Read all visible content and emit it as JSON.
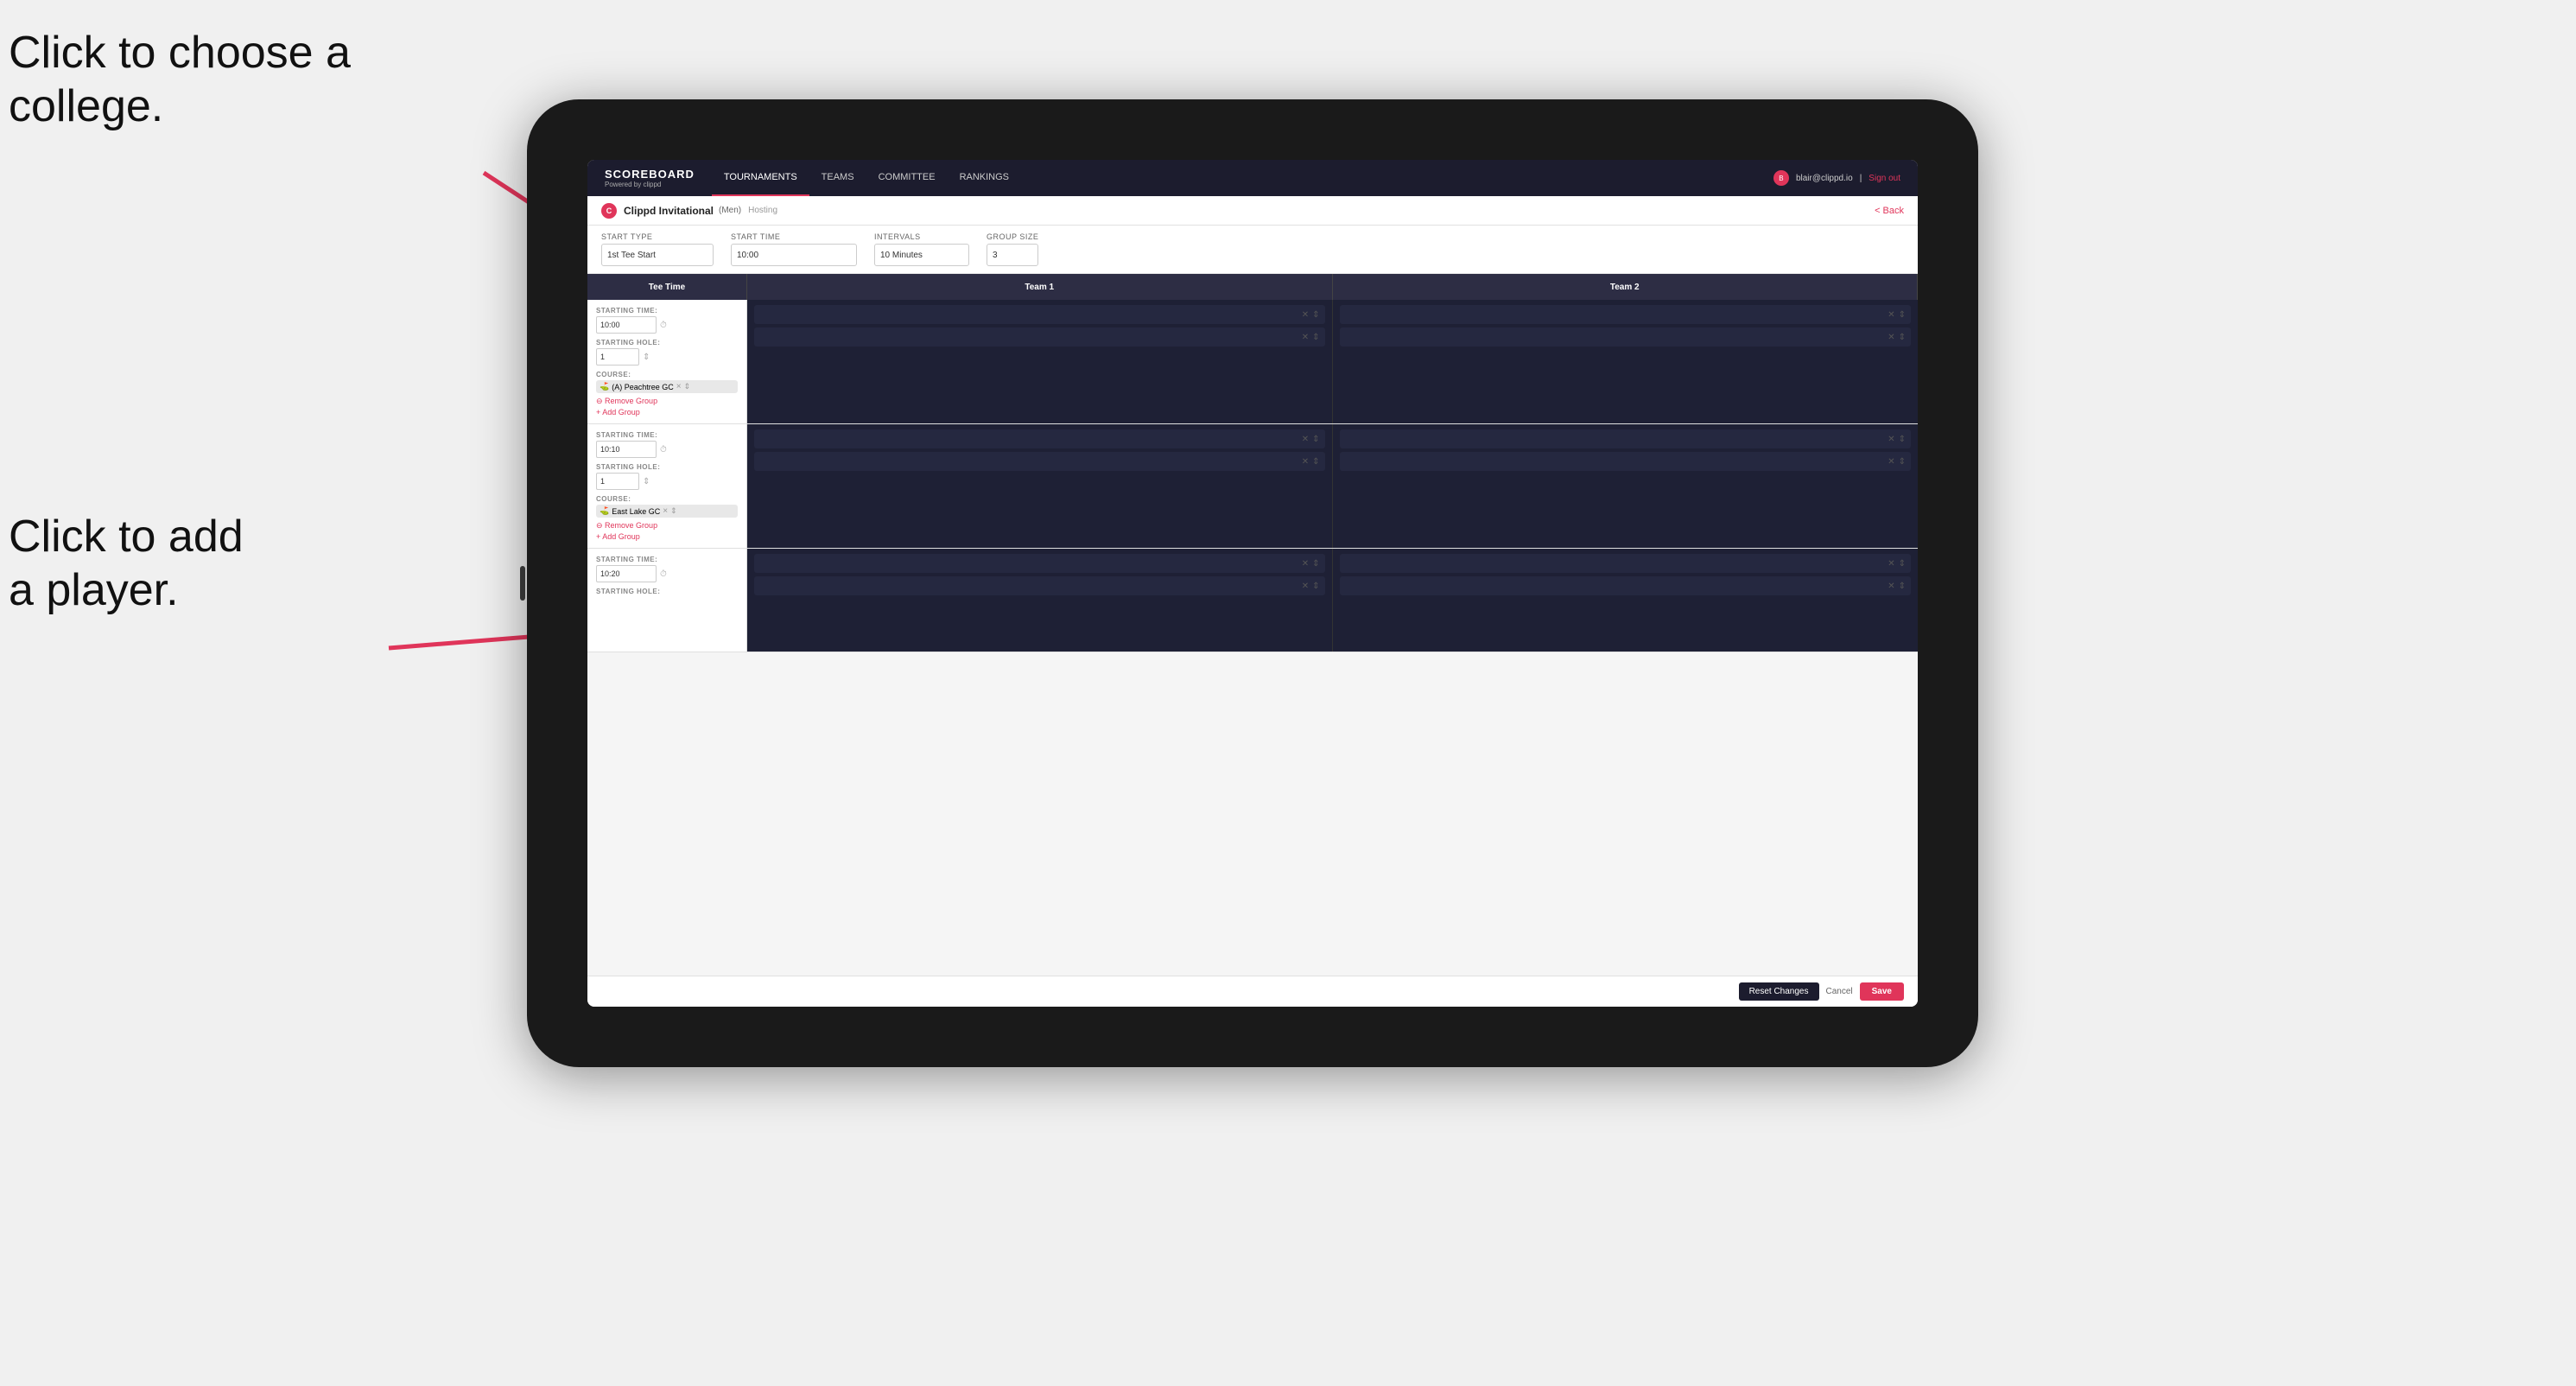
{
  "annotations": {
    "ann1_line1": "Click to choose a",
    "ann1_line2": "college.",
    "ann2_line1": "Click to add",
    "ann2_line2": "a player."
  },
  "nav": {
    "logo": "SCOREBOARD",
    "logo_sub": "Powered by clippd",
    "links": [
      "TOURNAMENTS",
      "TEAMS",
      "COMMITTEE",
      "RANKINGS"
    ],
    "active_link": "TOURNAMENTS",
    "user_email": "blair@clippd.io",
    "sign_out": "Sign out"
  },
  "sub_header": {
    "title": "Clippd Invitational",
    "badge": "(Men)",
    "hosting": "Hosting",
    "back": "< Back"
  },
  "form": {
    "start_type_label": "Start Type",
    "start_type_value": "1st Tee Start",
    "start_time_label": "Start Time",
    "start_time_value": "10:00",
    "intervals_label": "Intervals",
    "intervals_value": "10 Minutes",
    "group_size_label": "Group Size",
    "group_size_value": "3"
  },
  "table": {
    "col1": "Tee Time",
    "col2": "Team 1",
    "col3": "Team 2"
  },
  "rows": [
    {
      "starting_time": "10:00",
      "starting_hole": "1",
      "course": "(A) Peachtree GC",
      "team1_slots": 2,
      "team2_slots": 2,
      "actions": [
        "Remove Group",
        "Add Group"
      ]
    },
    {
      "starting_time": "10:10",
      "starting_hole": "1",
      "course": "East Lake GC",
      "team1_slots": 2,
      "team2_slots": 2,
      "actions": [
        "Remove Group",
        "Add Group"
      ]
    },
    {
      "starting_time": "10:20",
      "starting_hole": "",
      "course": "",
      "team1_slots": 2,
      "team2_slots": 2,
      "actions": []
    }
  ],
  "footer": {
    "reset": "Reset Changes",
    "cancel": "Cancel",
    "save": "Save"
  }
}
